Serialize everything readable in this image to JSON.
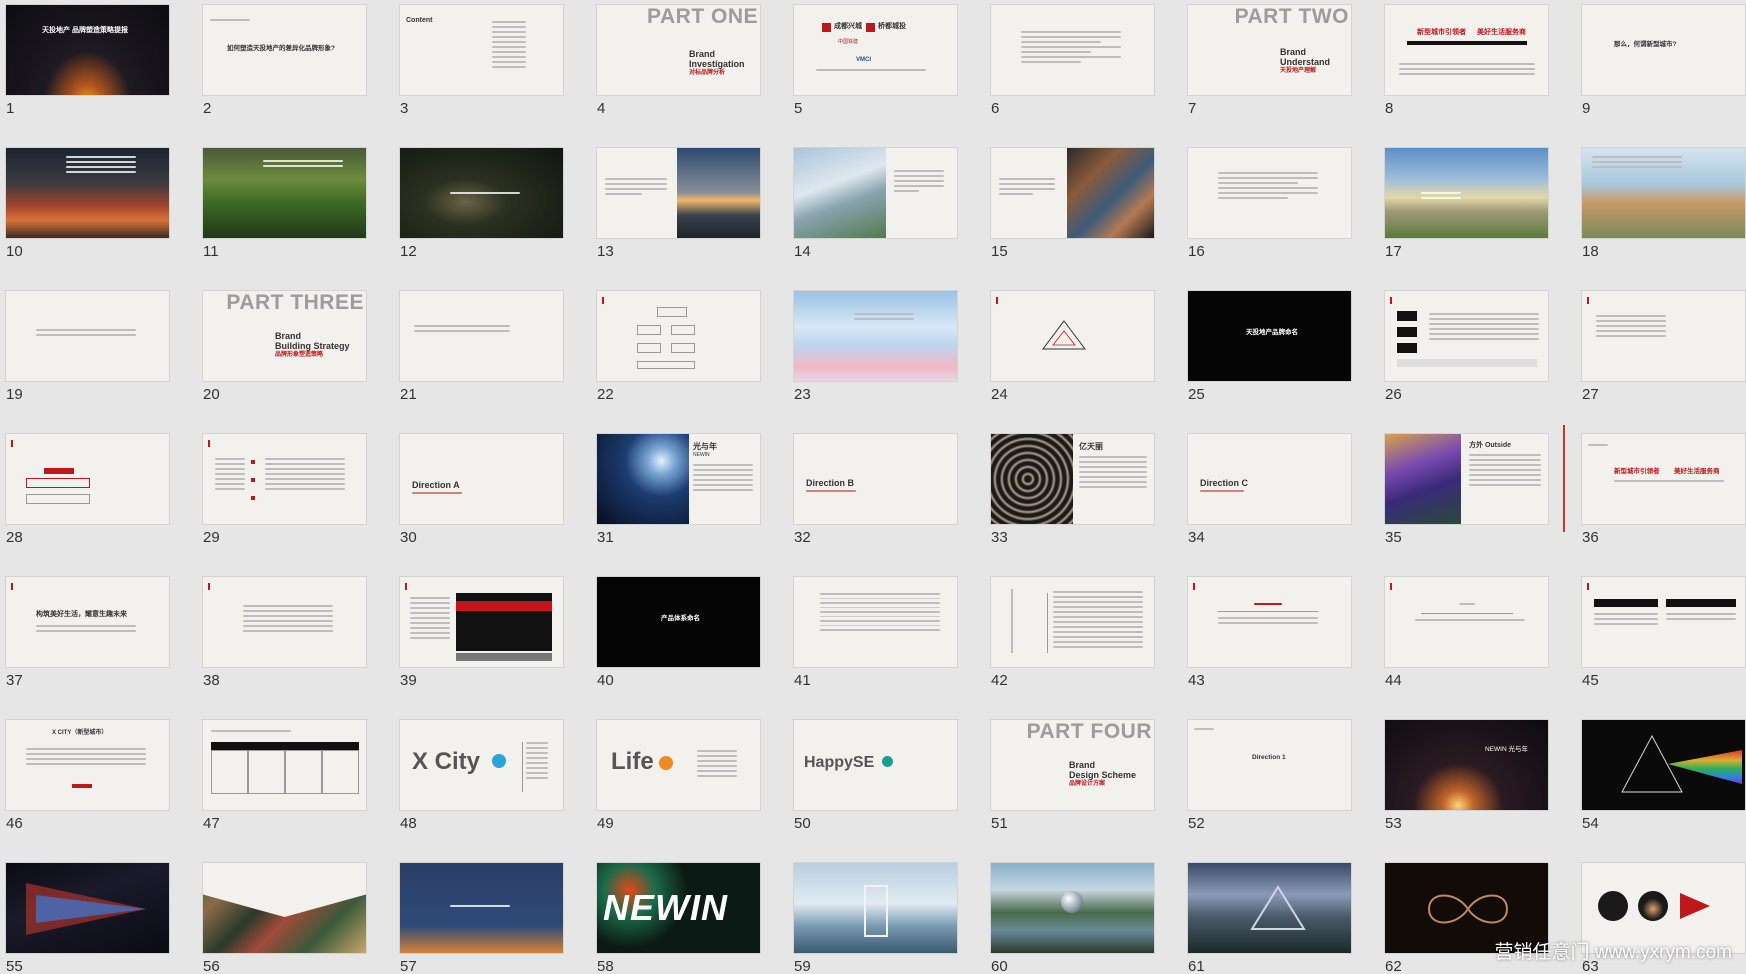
{
  "thumbnails": [
    {
      "n": "1"
    },
    {
      "n": "2"
    },
    {
      "n": "3"
    },
    {
      "n": "4"
    },
    {
      "n": "5"
    },
    {
      "n": "6"
    },
    {
      "n": "7"
    },
    {
      "n": "8"
    },
    {
      "n": "9"
    },
    {
      "n": "10"
    },
    {
      "n": "11"
    },
    {
      "n": "12"
    },
    {
      "n": "13"
    },
    {
      "n": "14"
    },
    {
      "n": "15"
    },
    {
      "n": "16"
    },
    {
      "n": "17"
    },
    {
      "n": "18"
    },
    {
      "n": "19"
    },
    {
      "n": "20"
    },
    {
      "n": "21"
    },
    {
      "n": "22"
    },
    {
      "n": "23"
    },
    {
      "n": "24"
    },
    {
      "n": "25"
    },
    {
      "n": "26"
    },
    {
      "n": "27"
    },
    {
      "n": "28"
    },
    {
      "n": "29"
    },
    {
      "n": "30"
    },
    {
      "n": "31"
    },
    {
      "n": "32"
    },
    {
      "n": "33"
    },
    {
      "n": "34"
    },
    {
      "n": "35"
    },
    {
      "n": "36"
    },
    {
      "n": "37"
    },
    {
      "n": "38"
    },
    {
      "n": "39"
    },
    {
      "n": "40"
    },
    {
      "n": "41"
    },
    {
      "n": "42"
    },
    {
      "n": "43"
    },
    {
      "n": "44"
    },
    {
      "n": "45"
    },
    {
      "n": "46"
    },
    {
      "n": "47"
    },
    {
      "n": "48"
    },
    {
      "n": "49"
    },
    {
      "n": "50"
    },
    {
      "n": "51"
    },
    {
      "n": "52"
    },
    {
      "n": "53"
    },
    {
      "n": "54"
    },
    {
      "n": "55"
    },
    {
      "n": "56"
    },
    {
      "n": "57"
    },
    {
      "n": "58"
    },
    {
      "n": "59"
    },
    {
      "n": "60"
    },
    {
      "n": "61"
    },
    {
      "n": "62"
    },
    {
      "n": "63"
    }
  ],
  "slides": {
    "s1": "天投地产 品牌塑造策略提报",
    "s2": "如何塑造天投地产的差异化品牌形象?",
    "s3": "Content",
    "s4": {
      "big": "PART ONE",
      "en1": "Brand",
      "en2": "Investigation",
      "zh": "对标品牌分析"
    },
    "s5": {
      "a": "成都兴城",
      "b": "桥都城投",
      "c": "中国铁建",
      "d": "VMCI"
    },
    "s7": {
      "big": "PART TWO",
      "en1": "Brand",
      "en2": "Understand",
      "zh": "天投地产理解"
    },
    "s8": {
      "a": "新型城市引领者",
      "b": "美好生活服务商"
    },
    "s9": "那么，何谓新型城市?",
    "s20": {
      "big": "PART THREE",
      "en1": "Brand",
      "en2": "Building Strategy",
      "zh": "品牌形象塑造策略"
    },
    "s25": "天投地产品牌命名",
    "s30": {
      "en": "Direction A"
    },
    "s31": {
      "zh": "光与年",
      "en": "NEWIN"
    },
    "s32": {
      "en": "Direction B"
    },
    "s33": {
      "zh": "亿天丽"
    },
    "s34": {
      "en": "Direction C"
    },
    "s35": {
      "zh": "方外 Outside"
    },
    "s36": {
      "a": "新型城市引领者",
      "b": "美好生活服务商"
    },
    "s37": "构筑美好生活，耀意生趣未来",
    "s40": "产品体系命名",
    "s46": "X CITY（新型城市）",
    "s48": "X City",
    "s49": "Life",
    "s50": "HappySE",
    "s51": {
      "big": "PART FOUR",
      "en1": "Brand",
      "en2": "Design Scheme",
      "zh": "品牌设计方案"
    },
    "s52": "Direction 1",
    "s53": "NEWIN 光与年",
    "s58": "NEWIN"
  },
  "watermark": "营销任意门 www.yxrym.com",
  "colors": {
    "background": "#e6e6e6",
    "accent": "#c0171c"
  }
}
